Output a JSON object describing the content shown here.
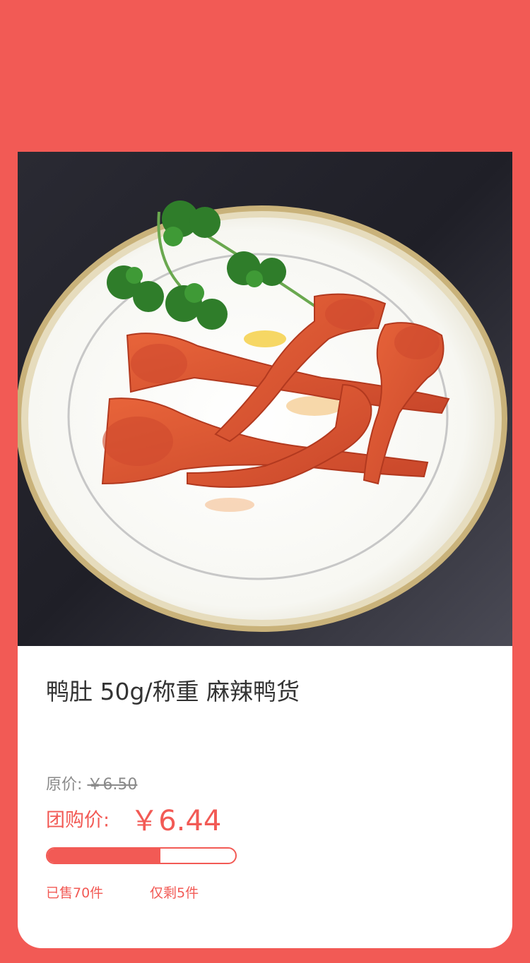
{
  "product": {
    "name": "鸭肚 50g/称重 麻辣鸭货",
    "original_price_label": "原价:",
    "original_price": "￥6.50",
    "group_price_label": "团购价:",
    "group_price": "￥6.44",
    "sold_text": "已售70件",
    "remaining_text": "仅剩5件",
    "sold_progress": 0.6,
    "image_alt": "鸭肚"
  },
  "colors": {
    "background": "#f25a55",
    "accent": "#f25a55",
    "card": "#ffffff",
    "title_text": "#333333",
    "muted_text": "#8a8a8a"
  }
}
